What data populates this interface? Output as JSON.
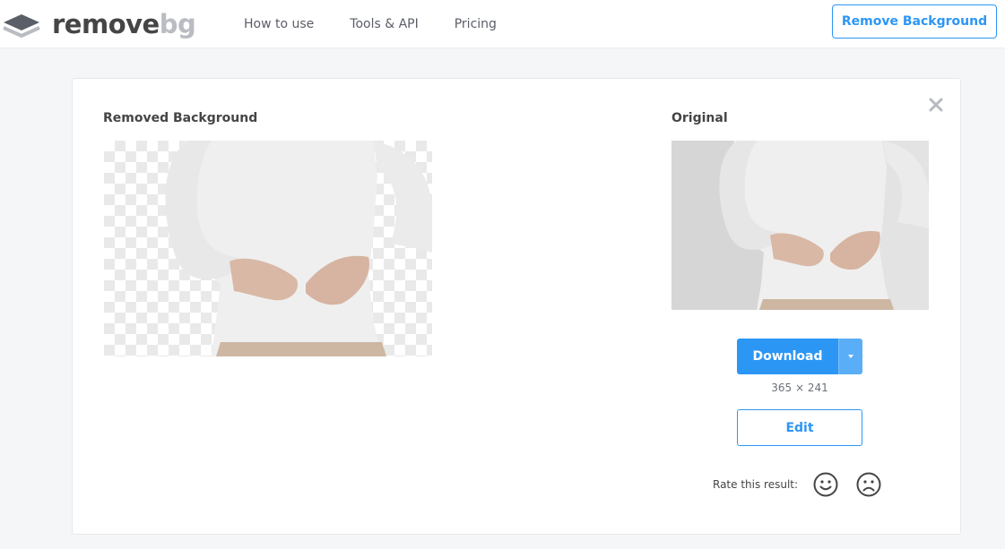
{
  "header": {
    "logo": {
      "word1": "remove",
      "word2": "bg"
    },
    "nav": [
      "How to use",
      "Tools & API",
      "Pricing"
    ],
    "cta_label": "Remove Background"
  },
  "result": {
    "removed_title": "Removed Background",
    "original_title": "Original",
    "download_label": "Download",
    "dimensions": "365 × 241",
    "edit_label": "Edit",
    "rate_label": "Rate this result:"
  },
  "icons": {
    "close": "close-icon",
    "caret": "chevron-down-icon",
    "happy": "smiley-face-icon",
    "sad": "sad-face-icon"
  },
  "colors": {
    "accent": "#2c96f5",
    "text": "#454545",
    "logo_light": "#b9bcc2"
  }
}
